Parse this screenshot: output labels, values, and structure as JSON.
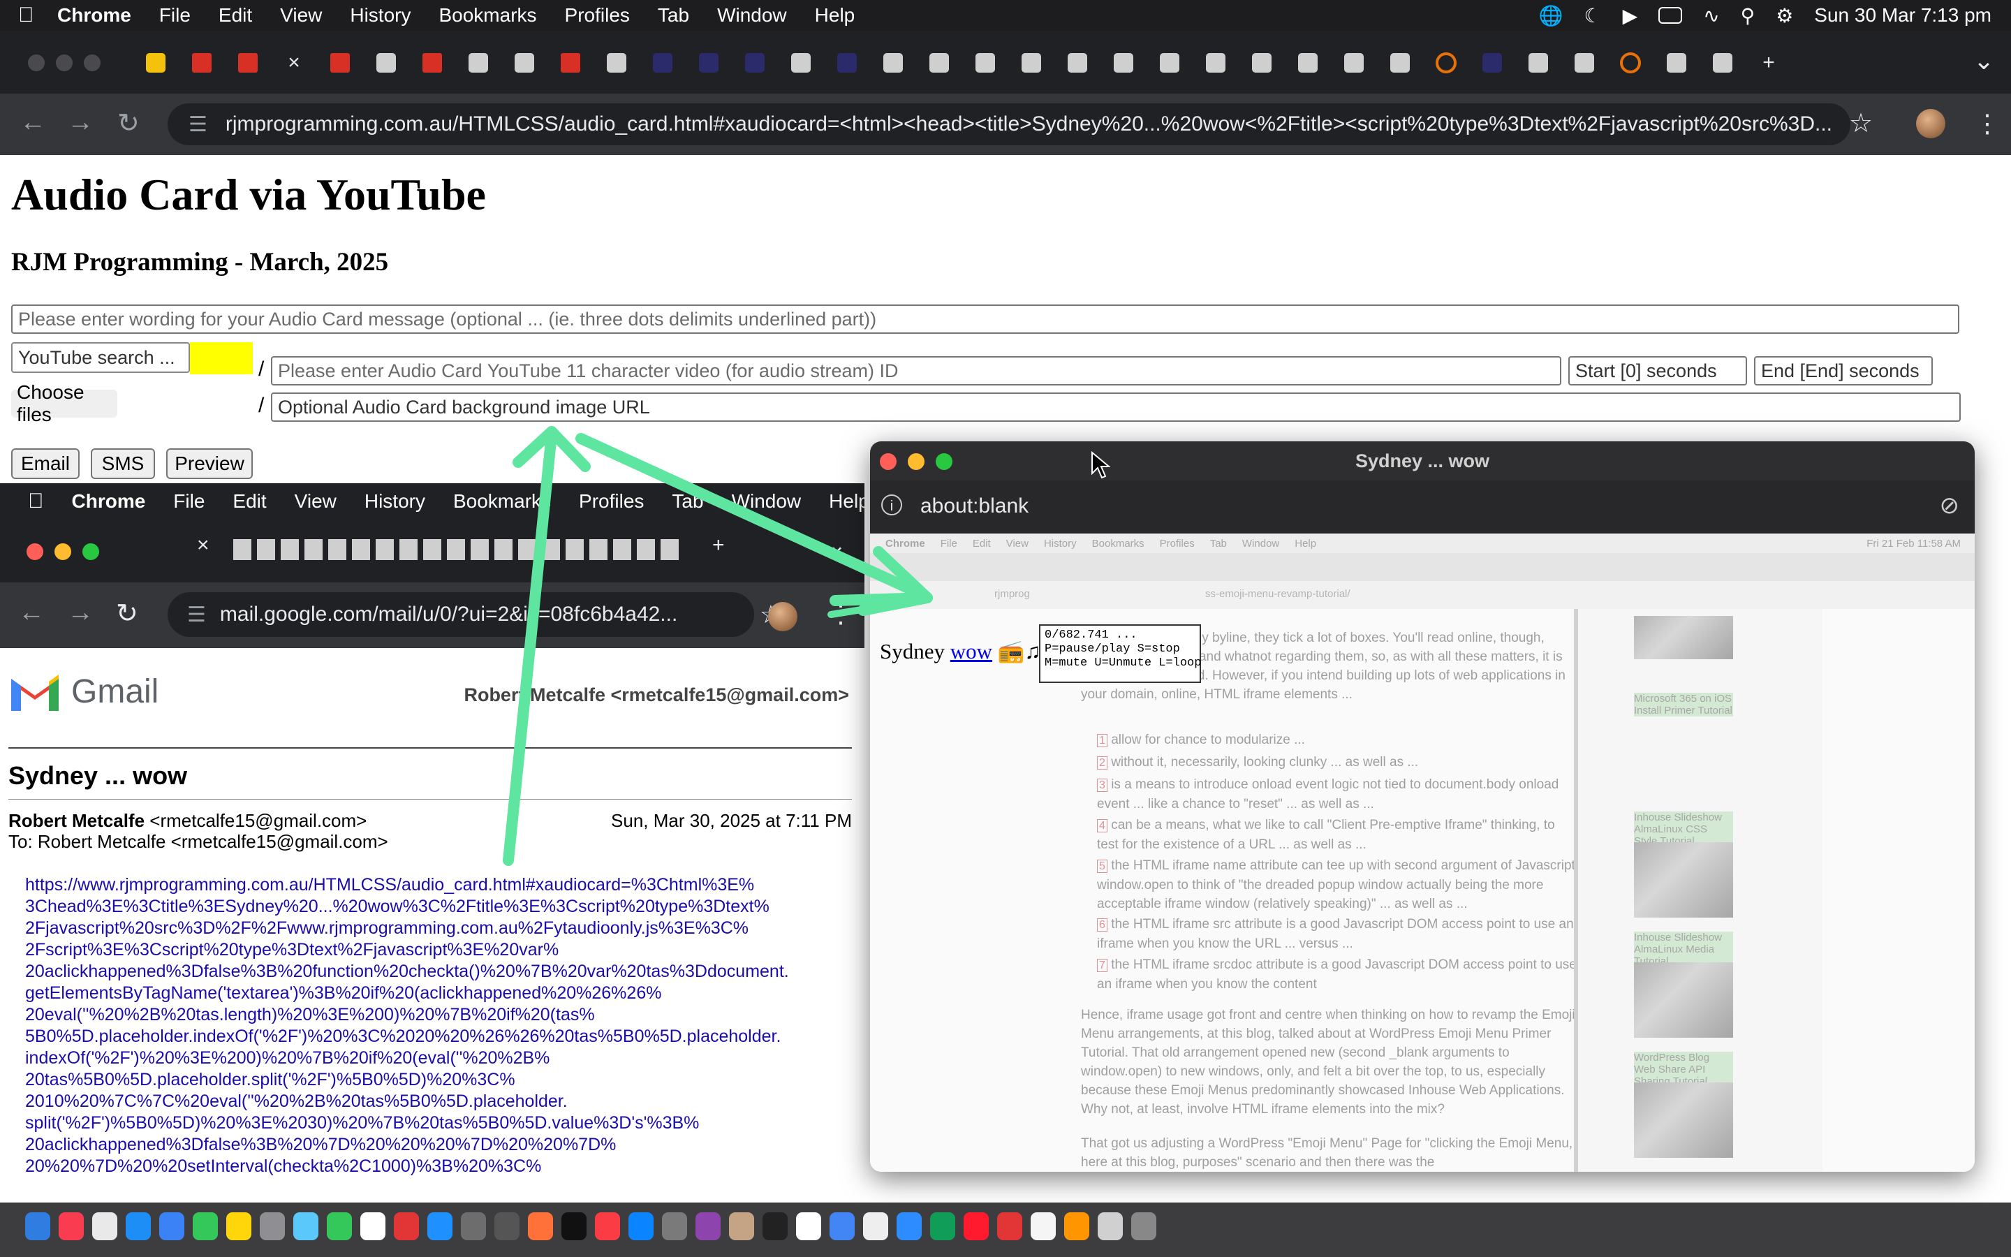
{
  "menubar": {
    "app": "Chrome",
    "items": [
      "File",
      "Edit",
      "View",
      "History",
      "Bookmarks",
      "Profiles",
      "Tab",
      "Window",
      "Help"
    ],
    "datetime": "Sun 30 Mar  7:13 pm"
  },
  "browser": {
    "url": "rjmprogramming.com.au/HTMLCSS/audio_card.html#xaudiocard=<html><head><title>Sydney%20...%20wow<%2Ftitle><script%20type%3Dtext%2Fjavascript%20src%3D...",
    "tab_close": "×",
    "new_tab": "+"
  },
  "page": {
    "title": "Audio Card via YouTube",
    "subtitle": "RJM Programming - March, 2025",
    "message_placeholder": "Please enter wording for your Audio Card message (optional ... (ie. three dots delimits underlined part))",
    "youtube_search_placeholder": "YouTube search ...",
    "video_id_placeholder": "Please enter Audio Card YouTube 11 character video (for audio stream) ID",
    "start_placeholder": "Start [0] seconds",
    "end_placeholder": "End [End] seconds",
    "choose_files": "Choose files",
    "background_placeholder": "Optional  Audio Card background image URL",
    "slash": "/",
    "buttons": {
      "email": "Email",
      "sms": "SMS",
      "preview": "Preview"
    }
  },
  "gmail_window": {
    "menubar": [
      "Chrome",
      "File",
      "Edit",
      "View",
      "History",
      "Bookmarks",
      "Profiles",
      "Tab",
      "Window",
      "Help"
    ],
    "url": "mail.google.com/mail/u/0/?ui=2&ik=08fc6b4a42...",
    "logo_text": "Gmail",
    "header_from": "Robert Metcalfe <rmetcalfe15@gmail.com>",
    "subject": "Sydney ... wow",
    "sender_name": "Robert Metcalfe",
    "sender_email": "<rmetcalfe15@gmail.com>",
    "to": "To: Robert Metcalfe <rmetcalfe15@gmail.com>",
    "date": "Sun, Mar 30, 2025 at 7:11 PM",
    "body_lines": [
      "https://www.rjmprogramming.com.au/HTMLCSS/audio_card.html#xaudiocard=%3Chtml%3E%",
      "3Chead%3E%3Ctitle%3ESydney%20...%20wow%3C%2Ftitle%3E%3Cscript%20type%3Dtext%",
      "2Fjavascript%20src%3D%2F%2Fwww.rjmprogramming.com.au%2Fytaudioonly.js%3E%3C%",
      "2Fscript%3E%3Cscript%20type%3Dtext%2Fjavascript%3E%20var%",
      "20aclickhappened%3Dfalse%3B%20function%20checkta()%20%7B%20var%20tas%3Ddocument.",
      "getElementsByTagName('textarea')%3B%20if%20(aclickhappened%20%26%26%",
      "20eval(''%20%2B%20tas.length)%20%3E%200)%20%7B%20if%20(tas%",
      "5B0%5D.placeholder.indexOf('%2F')%20%3C%2020%20%26%26%20tas%5B0%5D.placeholder.",
      "indexOf('%2F')%20%3E%200)%20%7B%20if%20(eval(''%20%2B%",
      "20tas%5B0%5D.placeholder.split('%2F')%5B0%5D)%20%3C%",
      "2010%20%7C%7C%20eval(''%20%2B%20tas%5B0%5D.placeholder.",
      "split('%2F')%5B0%5D)%20%3E%2030)%20%7B%20tas%5B0%5D.value%3D's'%3B%",
      "20aclickhappened%3Dfalse%3B%20%7D%20%20%20%7D%20%20%7D%",
      "20%20%7D%20%20setInterval(checkta%2C1000)%3B%20%3C%"
    ]
  },
  "popup_window": {
    "title": "Sydney ... wow",
    "address": "about:blank",
    "sydney_text": "Sydney",
    "wow_link": "wow",
    "tooltip": "0/682.741 ...\nP=pause/play S=stop\nM=mute U=Unmute L=loop",
    "embedded": {
      "menubar": [
        "Chrome",
        "File",
        "Edit",
        "View",
        "History",
        "Bookmarks",
        "Profiles",
        "Tab",
        "Window",
        "Help"
      ],
      "datetime": "Fri 21 Feb  11:58 AM",
      "url_fragment": "ss-emoji-menu-revamp-tutorial/",
      "url_prefix": "rjmprog",
      "para1": "... being our company byline, they tick a lot of boxes. You'll read online, though, issues with security and whatnot regarding them, so, as with all these matters, it is better to read around. However, if you intend building up lots of web applications in your domain, online, HTML iframe elements ...",
      "list": [
        {
          "num": "1",
          "text": "allow for chance to modularize ..."
        },
        {
          "num": "2",
          "text": "without it, necessarily, looking clunky ... as well as ..."
        },
        {
          "num": "3",
          "text": "is a means to introduce onload event logic not tied to document.body onload event ... like a chance to \"reset\" ... as well as ..."
        },
        {
          "num": "4",
          "text": "can be a means, what we like to call \"Client Pre-emptive Iframe\" thinking, to test for the existence of a URL ... as well as ..."
        },
        {
          "num": "5",
          "text": "the HTML iframe name attribute can tee up with second argument of Javascript window.open to think of \"the dreaded popup window actually being the more acceptable iframe window (relatively speaking)\" ... as well as ..."
        },
        {
          "num": "6",
          "text": "the HTML iframe src attribute is a good Javascript DOM access point to use an iframe when you know the URL ... versus ..."
        },
        {
          "num": "7",
          "text": "the HTML iframe srcdoc attribute is a good Javascript DOM access point to use an iframe when you know the content"
        }
      ],
      "para2": "Hence, iframe usage got front and centre when thinking on how to revamp the Emoji Menu arrangements, at this blog, talked about at WordPress Emoji Menu Primer Tutorial. That old arrangement opened new (second _blank arguments to window.open) to new windows, only, and felt a bit over the top, to us, especially because these Emoji Menus predominantly showcased Inhouse Web Applications. Why not, at least, involve HTML iframe elements into the mix?",
      "para3": "That got us adjusting a WordPress \"Emoji Menu\" Page for \"clicking the Emoji Menu, here at this blog, purposes\" scenario and then there was the",
      "sidebar": [
        "Microsoft 365 on iOS Install Primer Tutorial",
        "Inhouse Slideshow AlmaLinux CSS Style Tutorial",
        "Inhouse Slideshow AlmaLinux Media Tutorial",
        "WordPress Blog Web Share API Sharing Tutorial"
      ]
    }
  },
  "colors": {
    "annotation_arrow": "#5ee6a0",
    "youtube_search_highlight": "#ffff00",
    "gmail_link": "#1a0dab"
  }
}
